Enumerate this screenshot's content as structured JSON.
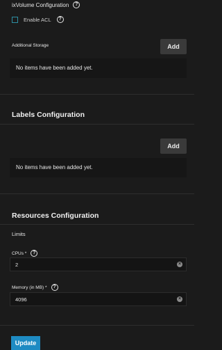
{
  "ixvolume": {
    "title": "ixVolume Configuration",
    "enable_acl_label": "Enable ACL"
  },
  "additional_storage": {
    "label": "Additional Storage",
    "add_label": "Add",
    "empty_text": "No items have been added yet."
  },
  "labels_config": {
    "title": "Labels Configuration",
    "add_label": "Add",
    "empty_text": "No items have been added yet."
  },
  "resources": {
    "title": "Resources Configuration",
    "limits_label": "Limits",
    "cpus_label": "CPUs *",
    "cpus_value": "2",
    "memory_label": "Memory (in MB) *",
    "memory_value": "4096"
  },
  "footer": {
    "update_label": "Update"
  },
  "icons": {
    "help": "?",
    "clear": "×"
  },
  "colors": {
    "background": "#1b1b1b",
    "accent": "#1e8bc3",
    "checkbox_border": "#2d8fa3"
  }
}
